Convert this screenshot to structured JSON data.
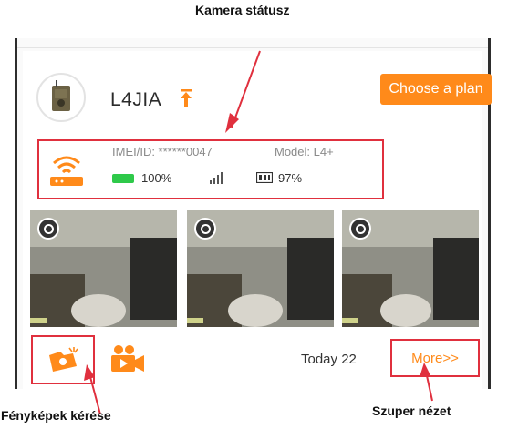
{
  "annotations": {
    "camera_status": "Kamera státusz",
    "photo_request": "Fényképek kérése",
    "super_view": "Szuper nézet"
  },
  "camera": {
    "name": "L4JIA",
    "imei": "IMEI/ID: ******0047",
    "model": "Model: L4+",
    "battery": "100%",
    "storage": "97%"
  },
  "plan_button": {
    "label": "Choose a plan"
  },
  "footer": {
    "today": "Today 22",
    "more": "More>>"
  },
  "icons": {
    "upgrade": "arrow-up-icon",
    "router": "router-icon",
    "signal": "signal-icon",
    "sd_card": "sd-card-icon",
    "view": "view-icon",
    "photo_request": "photo-request-icon",
    "video": "video-camera-icon"
  },
  "colors": {
    "accent": "#ff8a1a",
    "highlight_box": "#e0303e",
    "battery": "#2ec94a"
  }
}
